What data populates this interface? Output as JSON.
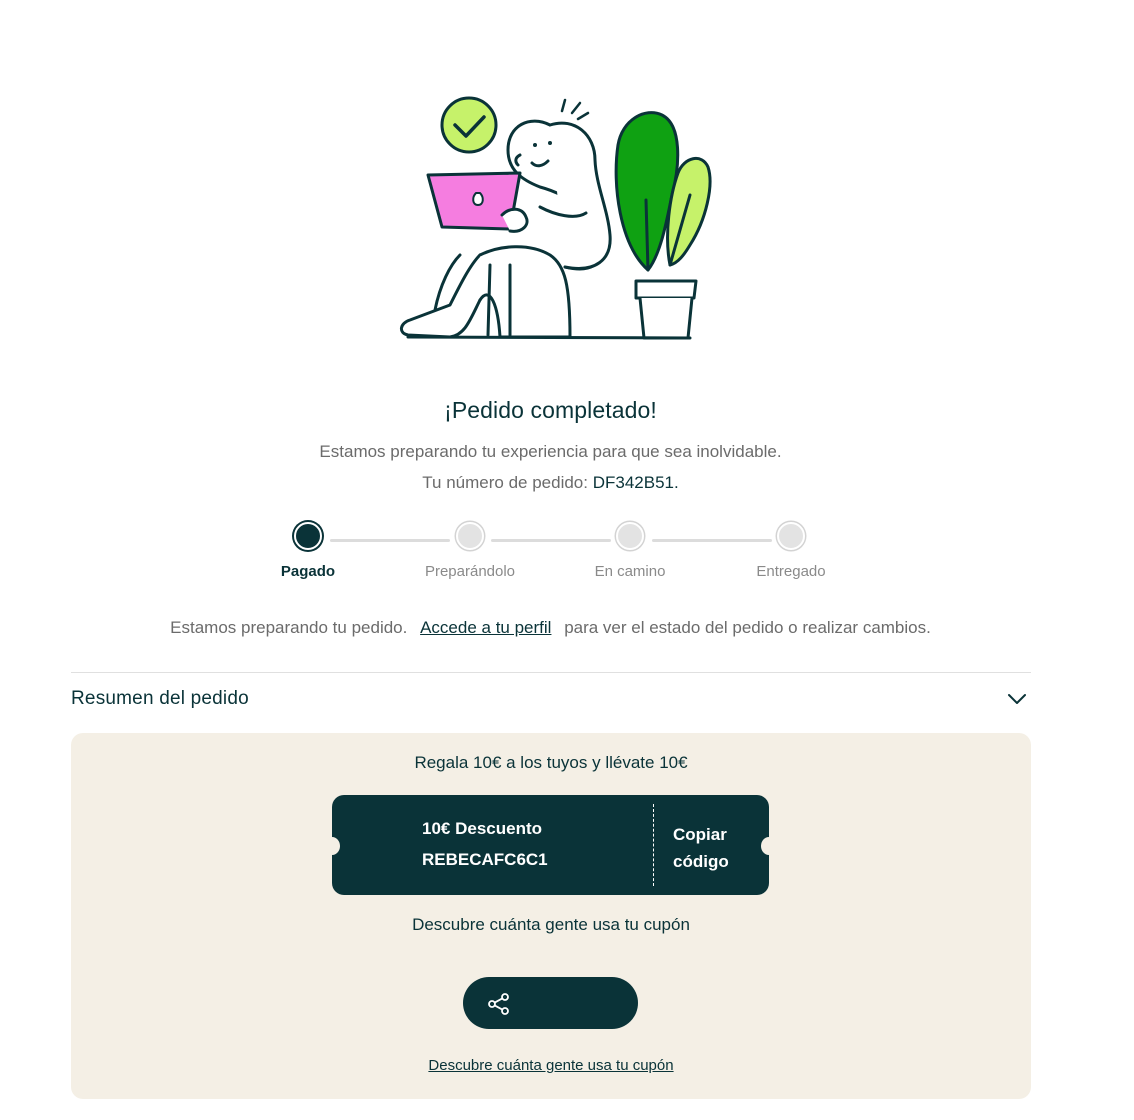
{
  "header": {
    "title": "¡Pedido completado!",
    "subtitle": "Estamos preparando tu experiencia para que sea inolvidable.",
    "order_prefix": "Tu número de pedido:",
    "order_number": "DF342B51."
  },
  "stepper": {
    "steps": [
      {
        "label": "Pagado",
        "active": true
      },
      {
        "label": "Preparándolo",
        "active": false
      },
      {
        "label": "En camino",
        "active": false
      },
      {
        "label": "Entregado",
        "active": false
      }
    ]
  },
  "info": {
    "text_before": "Estamos preparando tu pedido.",
    "link": "Accede a tu perfil",
    "text_after": "para ver el estado del pedido o realizar cambios."
  },
  "summary": {
    "title": "Resumen del pedido",
    "icon": "chevron-down-icon"
  },
  "promo": {
    "title": "Regala 10€ a los tuyos y llévate 10€",
    "coupon_discount": "10€ Descuento",
    "coupon_code": "REBECAFC6C1",
    "copy_line1": "Copiar",
    "copy_line2": "código",
    "discover_text": "Descubre cuánta gente usa tu cupón",
    "share_icon": "share-icon",
    "discover_link": "Descubre cuánta gente usa tu cupón"
  },
  "colors": {
    "primary": "#0a3338",
    "promo_bg": "#f4efe5",
    "muted_text": "#6b6b6b",
    "illustration_green": "#0fa112",
    "illustration_lime": "#c6f26a",
    "illustration_pink": "#f57de0"
  }
}
